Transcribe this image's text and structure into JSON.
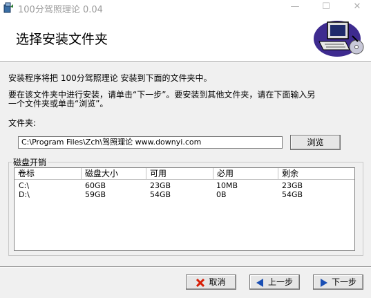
{
  "window": {
    "title": "100分驾照理论 0.04",
    "minimize": "—",
    "maximize": "☐",
    "close": "✕"
  },
  "header": {
    "title": "选择安装文件夹"
  },
  "body": {
    "intro": "安装程序将把 100分驾照理论 安装到下面的文件夹中。",
    "hint_line1": "要在该文件夹中进行安装，请单击“下一步”。要安装到其他文件夹，请在下面输入另",
    "hint_line2": "一个文件夹或单击“浏览”。",
    "folder_label": "文件夹:",
    "folder_value": "C:\\Program Files\\Zch\\驾照理论 www.downyi.com",
    "browse_label": "浏览"
  },
  "disk": {
    "group_label": "磁盘开销",
    "columns": [
      "卷标",
      "磁盘大小",
      "可用",
      "必用",
      "剩余"
    ],
    "rows": [
      [
        "C:\\",
        "60GB",
        "23GB",
        "10MB",
        "23GB"
      ],
      [
        "D:\\",
        "59GB",
        "54GB",
        "0B",
        "54GB"
      ]
    ]
  },
  "footer": {
    "cancel_label": "取消",
    "back_label": "上一步",
    "next_label": "下一步"
  },
  "colors": {
    "cancel_icon": "#d81e06",
    "nav_icon": "#1a4fb4"
  }
}
